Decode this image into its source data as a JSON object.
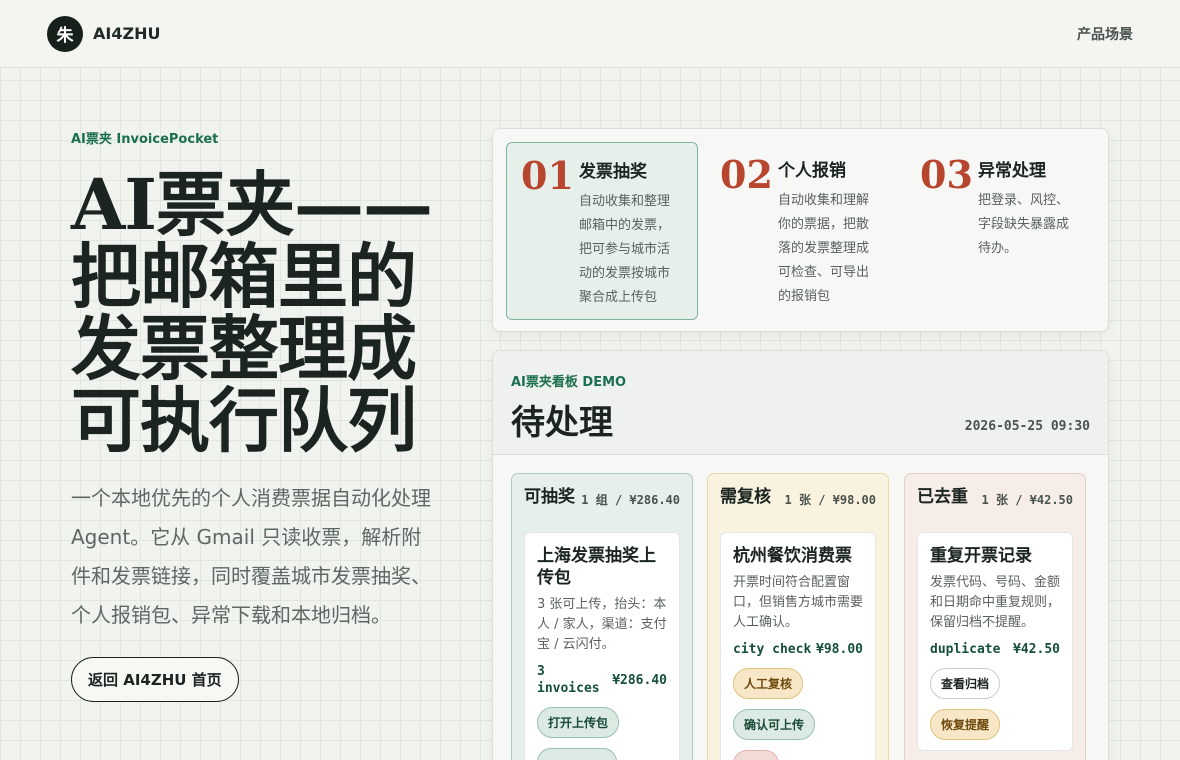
{
  "header": {
    "logo_char": "朱",
    "brand": "AI4ZHU",
    "nav_link": "产品场景"
  },
  "hero": {
    "eyebrow": "AI票夹 InvoicePocket",
    "title_lines": [
      "AI票夹——",
      "把邮箱里的",
      "发票整理成",
      "可执行队列"
    ],
    "description": "一个本地优先的个人消费票据自动化处理 Agent。它从 Gmail 只读收票，解析附件和发票链接，同时覆盖城市发票抽奖、个人报销包、异常下载和本地归档。",
    "cta": "返回 AI4ZHU 首页"
  },
  "features": [
    {
      "num": "01",
      "title": "发票抽奖",
      "desc": "自动收集和整理邮箱中的发票，把可参与城市活动的发票按城市聚合成上传包"
    },
    {
      "num": "02",
      "title": "个人报销",
      "desc": "自动收集和理解你的票据，把散落的发票整理成可检查、可导出的报销包"
    },
    {
      "num": "03",
      "title": "异常处理",
      "desc": "把登录、风控、字段缺失暴露成待办。"
    }
  ],
  "board": {
    "eyebrow": "AI票夹看板 DEMO",
    "title": "待处理",
    "time": "2026-05-25 09:30",
    "columns": [
      {
        "title": "可抽奖",
        "count": "1 组 / ¥286.40",
        "card": {
          "title": "上海发票抽奖上传包",
          "desc": "3 张可上传，抬头：本人 / 家人，渠道：支付宝 / 云闪付。",
          "tag": "3 invoices",
          "amount": "¥286.40",
          "actions": [
            "打开上传包",
            ""
          ]
        }
      },
      {
        "title": "需复核",
        "count": "1 张 / ¥98.00",
        "card": {
          "title": "杭州餐饮消费票",
          "desc": "开票时间符合配置窗口，但销售方城市需要人工确认。",
          "tag": "city check",
          "amount": "¥98.00",
          "actions": [
            "人工复核",
            "确认可上传",
            ""
          ]
        }
      },
      {
        "title": "已去重",
        "count": "1 张 / ¥42.50",
        "card": {
          "title": "重复开票记录",
          "desc": "发票代码、号码、金额和日期命中重复规则，保留归档不提醒。",
          "tag": "duplicate",
          "amount": "¥42.50",
          "actions": [
            "查看归档",
            "恢复提醒"
          ]
        }
      }
    ]
  }
}
